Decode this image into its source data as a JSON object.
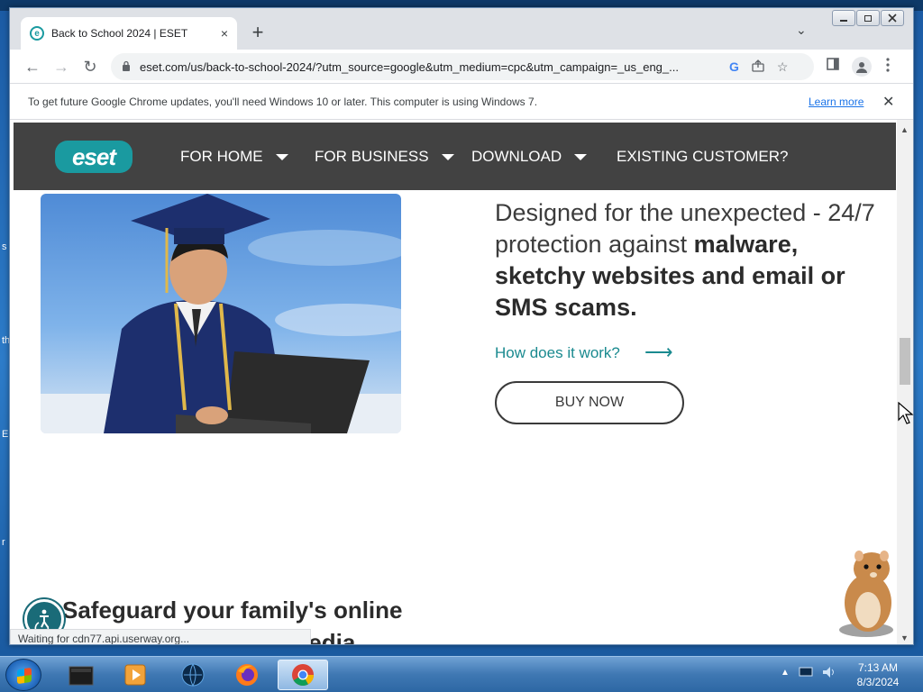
{
  "desktop": {
    "side_fragments": [
      "s",
      "th",
      "E",
      "r"
    ]
  },
  "browser": {
    "tab": {
      "title": "Back to School 2024 | ESET",
      "favicon": "e",
      "close_icon": "×"
    },
    "new_tab_icon": "+",
    "tab_list_icon": "⌄",
    "window_controls": [
      "minimize-icon",
      "restore-icon",
      "close-icon"
    ],
    "toolbar": {
      "url": "eset.com/us/back-to-school-2024/?utm_source=google&utm_medium=cpc&utm_campaign=_us_eng_...",
      "back_icon": "←",
      "forward_icon": "→",
      "reload_icon": "↻"
    },
    "infobar": {
      "message": "To get future Google Chrome updates, you'll need Windows 10 or later. This computer is using Windows 7.",
      "learn_more": "Learn more",
      "close": "✕"
    },
    "status_text": "Waiting for cdn77.api.userway.org..."
  },
  "page": {
    "logo_text": "eset",
    "nav": [
      {
        "label": "FOR HOME",
        "has_caret": true
      },
      {
        "label": "FOR BUSINESS",
        "has_caret": true
      },
      {
        "label": "DOWNLOAD",
        "has_caret": true
      },
      {
        "label": "EXISTING CUSTOMER?",
        "has_caret": false
      }
    ],
    "headline_light": "Designed for the unexpected - 24/7 protection against ",
    "headline_bold": "malware, sketchy websites and email or SMS scams.",
    "how_link": "How does it work?",
    "how_arrow": "⟶",
    "buy_button": "BUY NOW",
    "section2_line1": "Safeguard your family's online",
    "section2_line2": "ial media"
  },
  "taskbar": {
    "clock_time": "7:13 AM",
    "clock_date": "8/3/2024",
    "apps": [
      "windows-explorer",
      "media-player",
      "network-globe",
      "firefox",
      "chrome"
    ]
  },
  "colors": {
    "eset_teal": "#1a9aa0",
    "nav_bg": "#424242",
    "link": "#1a8a8f"
  }
}
